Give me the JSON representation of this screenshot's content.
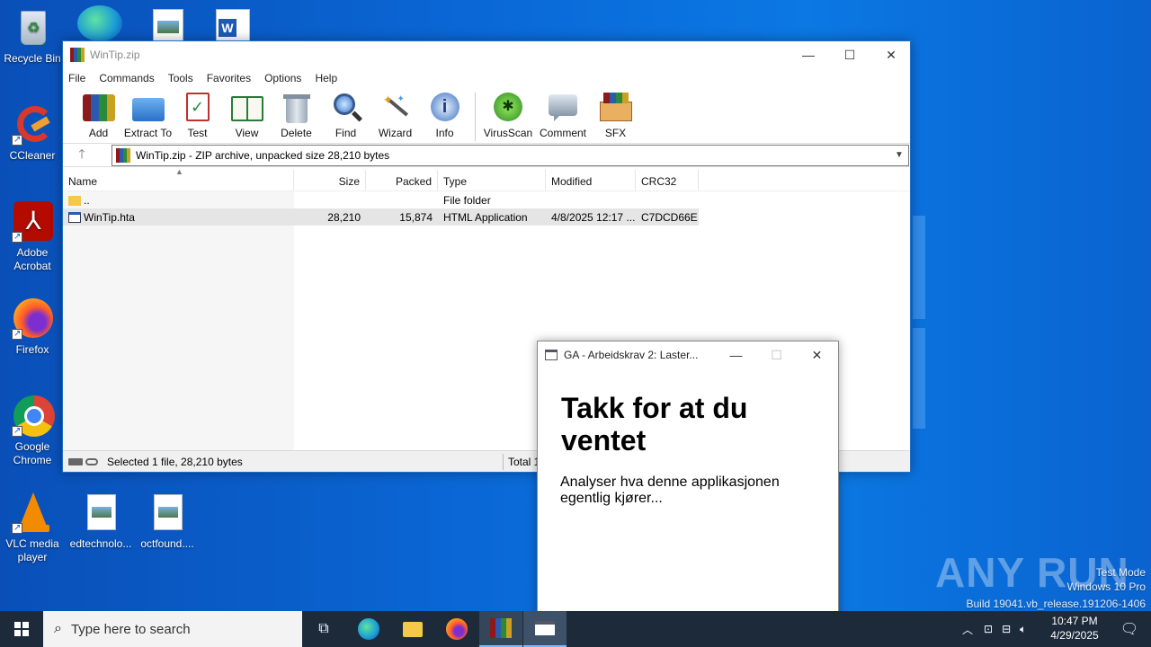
{
  "desktop": {
    "icons": [
      {
        "label": "Recycle Bin"
      },
      {
        "label": "CCleaner"
      },
      {
        "label": "Adobe Acrobat"
      },
      {
        "label": "Firefox"
      },
      {
        "label": "Google Chrome"
      },
      {
        "label": "VLC media player"
      },
      {
        "label": "edtechnolo..."
      },
      {
        "label": "octfound...."
      }
    ]
  },
  "winrar": {
    "title": "WinTip.zip",
    "menu": [
      "File",
      "Commands",
      "Tools",
      "Favorites",
      "Options",
      "Help"
    ],
    "toolbar": [
      "Add",
      "Extract To",
      "Test",
      "View",
      "Delete",
      "Find",
      "Wizard",
      "Info",
      "VirusScan",
      "Comment",
      "SFX"
    ],
    "address": "WinTip.zip - ZIP archive, unpacked size 28,210 bytes",
    "columns": [
      "Name",
      "Size",
      "Packed",
      "Type",
      "Modified",
      "CRC32"
    ],
    "rows": [
      {
        "name": "..",
        "size": "",
        "packed": "",
        "type": "File folder",
        "modified": "",
        "crc": ""
      },
      {
        "name": "WinTip.hta",
        "size": "28,210",
        "packed": "15,874",
        "type": "HTML Application",
        "modified": "4/8/2025 12:17 ...",
        "crc": "C7DCD66E"
      }
    ],
    "status_left": "Selected 1 file, 28,210 bytes",
    "status_right": "Total 1"
  },
  "hta": {
    "title": "GA - Arbeidskrav 2: Laster...",
    "heading": "Takk for at du ventet",
    "body": "Analyser hva denne applikasjonen egentlig kjører..."
  },
  "watermark": {
    "brand": "ANY RUN",
    "mode": "Test Mode",
    "os": "Windows 10 Pro",
    "build": "Build 19041.vb_release.191206-1406"
  },
  "taskbar": {
    "search_placeholder": "Type here to search",
    "time": "10:47 PM",
    "date": "4/29/2025"
  },
  "colors": {
    "desktop": "#0a6ad8",
    "taskbar": "#1c2a3a",
    "selection": "#e5e5e5"
  }
}
